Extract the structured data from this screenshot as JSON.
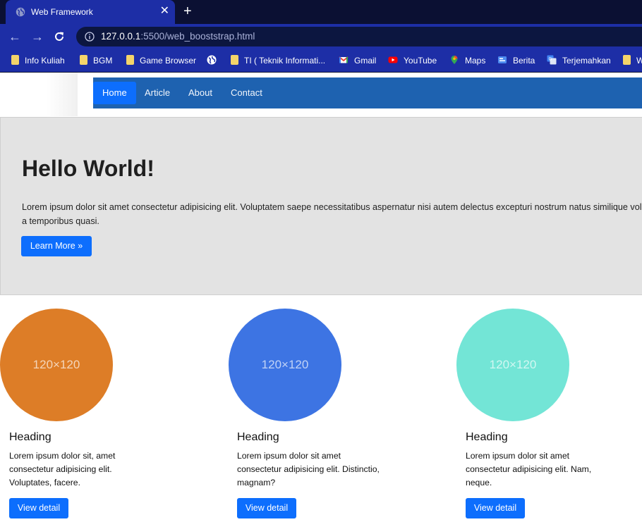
{
  "browser": {
    "tab_title": "Web Framework",
    "close_symbol": "✕",
    "newtab_symbol": "+",
    "url_host": "127.0.0.1",
    "url_path": ":5500/web_booststrap.html",
    "bookmarks": [
      {
        "label": "Info Kuliah",
        "icon": "folder"
      },
      {
        "label": "BGM",
        "icon": "folder"
      },
      {
        "label": "Game Browser",
        "icon": "folder"
      },
      {
        "label": "",
        "icon": "globe"
      },
      {
        "label": "TI ( Teknik Informati...",
        "icon": "folder"
      },
      {
        "label": "Gmail",
        "icon": "gmail"
      },
      {
        "label": "YouTube",
        "icon": "youtube"
      },
      {
        "label": "Maps",
        "icon": "maps"
      },
      {
        "label": "Berita",
        "icon": "news"
      },
      {
        "label": "Terjemahkan",
        "icon": "translate"
      },
      {
        "label": "W",
        "icon": "folder"
      }
    ]
  },
  "navbar": {
    "items": [
      {
        "label": "Home",
        "active": true
      },
      {
        "label": "Article",
        "active": false
      },
      {
        "label": "About",
        "active": false
      },
      {
        "label": "Contact",
        "active": false
      }
    ]
  },
  "jumbotron": {
    "title": "Hello World!",
    "text": "Lorem ipsum dolor sit amet consectetur adipisicing elit. Voluptatem saepe necessitatibus aspernatur nisi autem delectus excepturi nostrum natus similique voluptatibus, a temporibus quasi.",
    "button": "Learn More »"
  },
  "columns": [
    {
      "placeholder": "120×120",
      "color": "#dd7d27",
      "heading": "Heading",
      "text": "Lorem ipsum dolor sit, amet consectetur adipisicing elit. Voluptates, facere.",
      "button": "View detail"
    },
    {
      "placeholder": "120×120",
      "color": "#3d74e3",
      "heading": "Heading",
      "text": "Lorem ipsum dolor sit amet consectetur adipisicing elit. Distinctio, magnam?",
      "button": "View detail"
    },
    {
      "placeholder": "120×120",
      "color": "#73e5d6",
      "heading": "Heading",
      "text": "Lorem ipsum dolor sit amet consectetur adipisicing elit. Nam, neque.",
      "button": "View detail"
    }
  ],
  "colors": {
    "primary": "#0d6efd",
    "navbar": "#1e62b0",
    "chrome": "#1d2ea6",
    "tabstrip": "#0b1033"
  }
}
